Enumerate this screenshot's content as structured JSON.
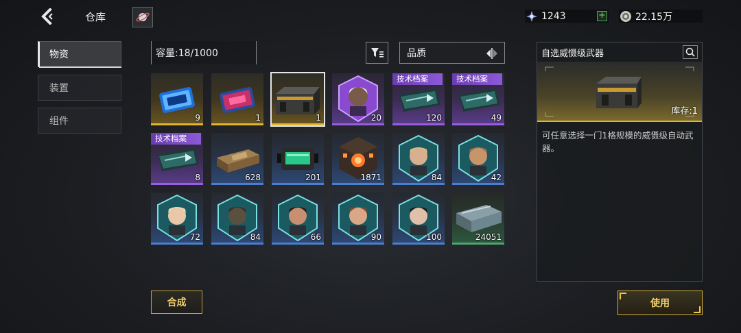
{
  "header": {
    "title": "仓库",
    "back_icon": "chevron-left-icon",
    "planet_icon": "planet-icon"
  },
  "currencies": [
    {
      "icon": "crystal-icon",
      "value": "1243",
      "has_plus": true
    },
    {
      "icon": "coin-icon",
      "value": "22.15万",
      "has_plus": false
    }
  ],
  "tabs": [
    {
      "label": "物资",
      "active": true
    },
    {
      "label": "装置",
      "active": false
    },
    {
      "label": "组件",
      "active": false
    }
  ],
  "inventory": {
    "capacity": "容量:18/1000",
    "sort_label": "品质",
    "items": [
      {
        "kind": "blue-chip",
        "quality": "gold",
        "count": "9"
      },
      {
        "kind": "red-chip",
        "quality": "gold",
        "count": "1"
      },
      {
        "kind": "crate",
        "quality": "gold",
        "count": "1",
        "selected": true
      },
      {
        "kind": "portrait-white",
        "quality": "purple",
        "count": "20"
      },
      {
        "kind": "file",
        "quality": "purple",
        "count": "120",
        "tag": "技术档案"
      },
      {
        "kind": "file",
        "quality": "purple",
        "count": "49",
        "tag": "技术档案"
      },
      {
        "kind": "file",
        "quality": "purple",
        "count": "8",
        "tag": "技术档案"
      },
      {
        "kind": "bullion",
        "quality": "blue",
        "count": "628"
      },
      {
        "kind": "battery",
        "quality": "blue",
        "count": "201"
      },
      {
        "kind": "cube",
        "quality": "blue",
        "count": "1871"
      },
      {
        "kind": "portrait-blond",
        "quality": "blue",
        "count": "84"
      },
      {
        "kind": "portrait-bald",
        "quality": "blue",
        "count": "42"
      },
      {
        "kind": "portrait-fair",
        "quality": "blue",
        "count": "72"
      },
      {
        "kind": "portrait-alien",
        "quality": "blue",
        "count": "84"
      },
      {
        "kind": "portrait-visor",
        "quality": "blue",
        "count": "66"
      },
      {
        "kind": "portrait-brown",
        "quality": "blue",
        "count": "90"
      },
      {
        "kind": "portrait-dark",
        "quality": "blue",
        "count": "100"
      },
      {
        "kind": "ingot",
        "quality": "green",
        "count": "24051"
      }
    ]
  },
  "detail": {
    "title": "自选威慑级武器",
    "stock": "库存:1",
    "description": "可任意选择一门1格规模的威慑级自动武器。"
  },
  "buttons": {
    "synthesize": "合成",
    "use": "使用"
  },
  "colors": {
    "gold": "#e0b530",
    "purple": "#9a5ce0",
    "blue": "#4a7fd0",
    "green": "#4aa86a",
    "tag": "#7a4ac4"
  }
}
